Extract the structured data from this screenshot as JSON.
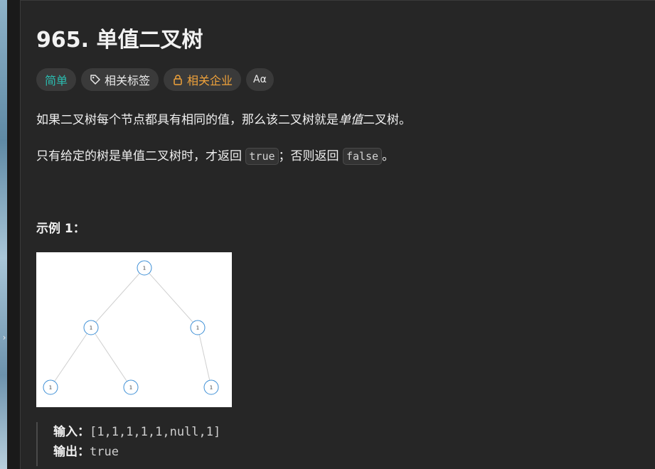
{
  "problem": {
    "title": "965. 单值二叉树"
  },
  "tags": {
    "difficulty": "简单",
    "topics": "相关标签",
    "companies": "相关企业",
    "translate": "Aα"
  },
  "description": {
    "p1_before": "如果二叉树每个节点都具有相同的值，那么该二叉树就是",
    "p1_emph": "单值",
    "p1_after": "二叉树。",
    "p2_before": "只有给定的树是单值二叉树时，才返回 ",
    "p2_true": "true",
    "p2_mid": "；否则返回 ",
    "p2_false": "false",
    "p2_end": "。"
  },
  "example1": {
    "heading": "示例 1：",
    "tree_node_value": "1",
    "input_label": "输入：",
    "input_value": "[1,1,1,1,1,null,1]",
    "output_label": "输出：",
    "output_value": "true"
  },
  "colors": {
    "difficulty": "#2bbcb0",
    "companies": "#f0a23a",
    "node_stroke": "#3d8fd6"
  }
}
